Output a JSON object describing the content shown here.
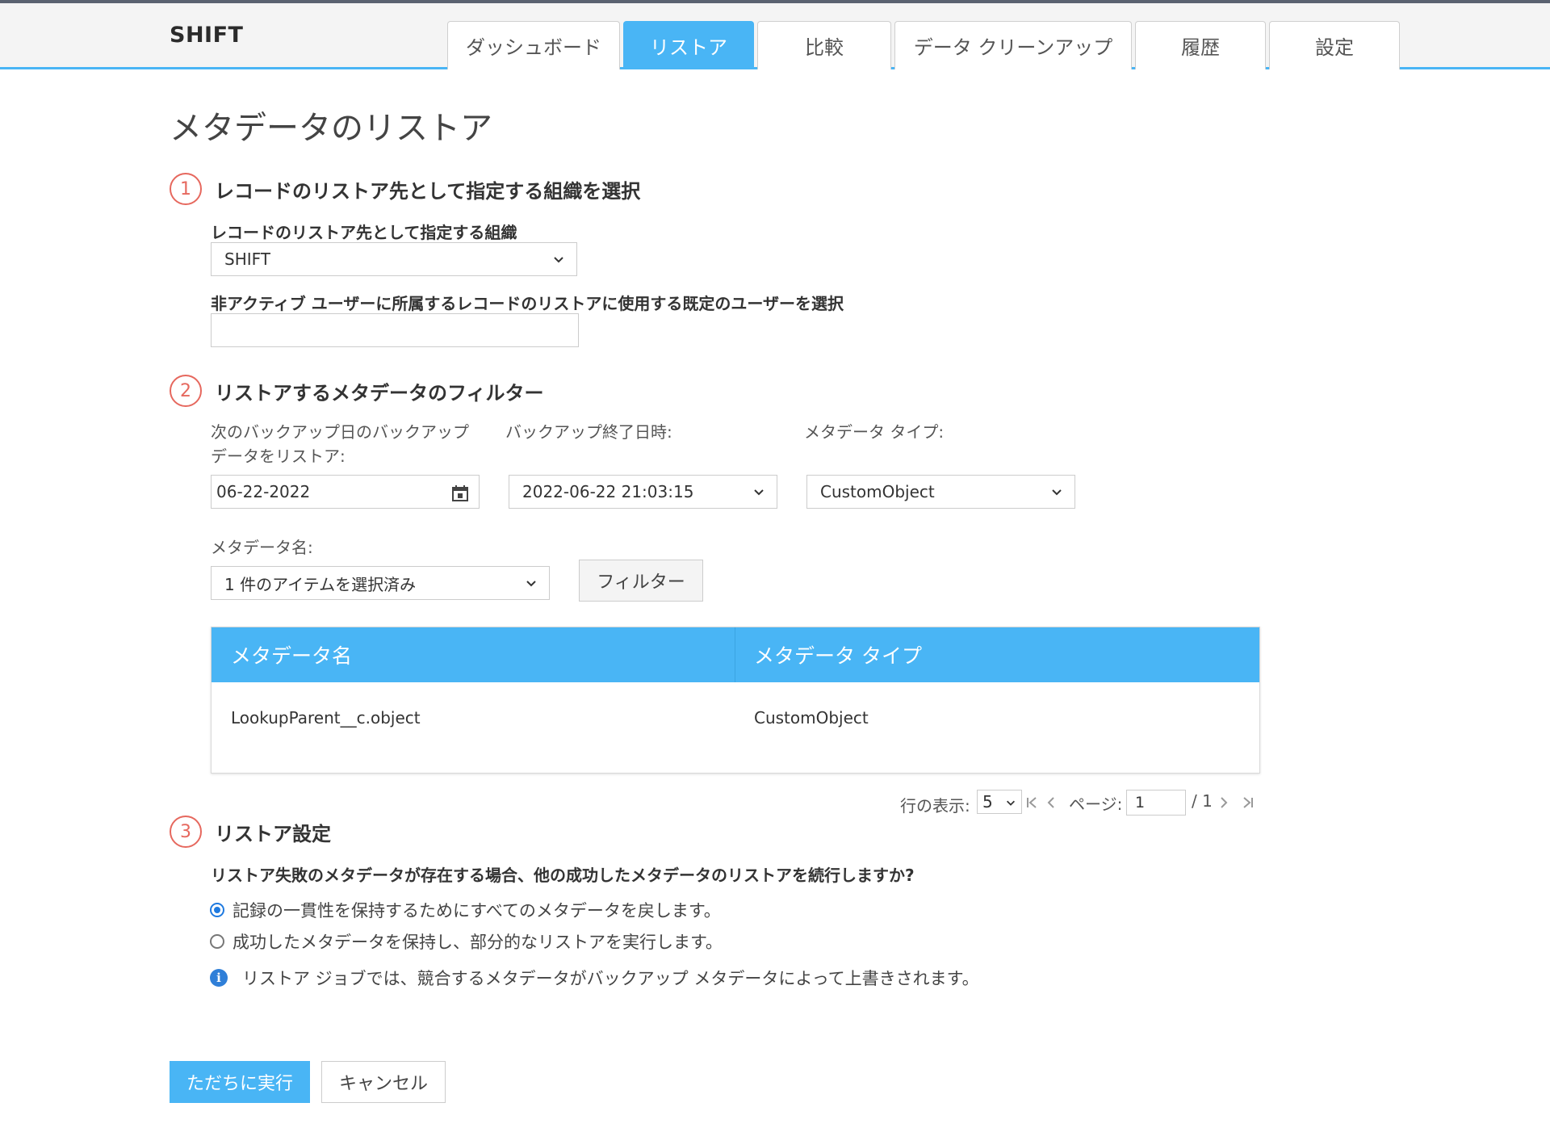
{
  "app": {
    "brand": "SHIFT"
  },
  "tabs": [
    {
      "label": "ダッシュボード"
    },
    {
      "label": "リストア"
    },
    {
      "label": "比較"
    },
    {
      "label": "データ クリーンアップ"
    },
    {
      "label": "履歴"
    },
    {
      "label": "設定"
    }
  ],
  "active_tab": "リストア",
  "page": {
    "title": "メタデータのリストア"
  },
  "step1": {
    "number": "1",
    "title": "レコードのリストア先として指定する組織を選択",
    "org_label": "レコードのリストア先として指定する組織",
    "org_value": "SHIFT",
    "user_label": "非アクティブ ユーザーに所属するレコードのリストアに使用する既定のユーザーを選択",
    "user_value": ""
  },
  "step2": {
    "number": "2",
    "title": "リストアするメタデータのフィルター",
    "backup_date_label": "次のバックアップ日のバックアップ データをリストア:",
    "backup_date_value": "06-22-2022",
    "backup_end_label": "バックアップ終了日時:",
    "backup_end_value": "2022-06-22 21:03:15",
    "metadata_type_label": "メタデータ タイプ:",
    "metadata_type_value": "CustomObject",
    "metadata_name_label": "メタデータ名:",
    "metadata_name_value": "1 件のアイテムを選択済み",
    "filter_button": "フィルター",
    "table": {
      "headers": [
        "メタデータ名",
        "メタデータ タイプ"
      ],
      "rows": [
        [
          "LookupParent__c.object",
          "CustomObject"
        ]
      ]
    },
    "pagination": {
      "rows_label": "行の表示:",
      "rows_value": "5",
      "page_label": "ページ:",
      "page_value": "1",
      "total_pages": "/ 1"
    }
  },
  "step3": {
    "number": "3",
    "title": "リストア設定",
    "question": "リストア失敗のメタデータが存在する場合、他の成功したメタデータのリストアを続行しますか?",
    "options": [
      {
        "label": "記録の一貫性を保持するためにすべてのメタデータを戻します。",
        "selected": true
      },
      {
        "label": "成功したメタデータを保持し、部分的なリストアを実行します。",
        "selected": false
      }
    ],
    "info": "リストア ジョブでは、競合するメタデータがバックアップ メタデータによって上書きされます。"
  },
  "actions": {
    "run_now": "ただちに実行",
    "cancel": "キャンセル"
  },
  "colors": {
    "accent": "#49b5f5",
    "step_circle": "#e6685e",
    "radio_selected": "#1f7ae0",
    "info_icon": "#2f7fd8"
  }
}
